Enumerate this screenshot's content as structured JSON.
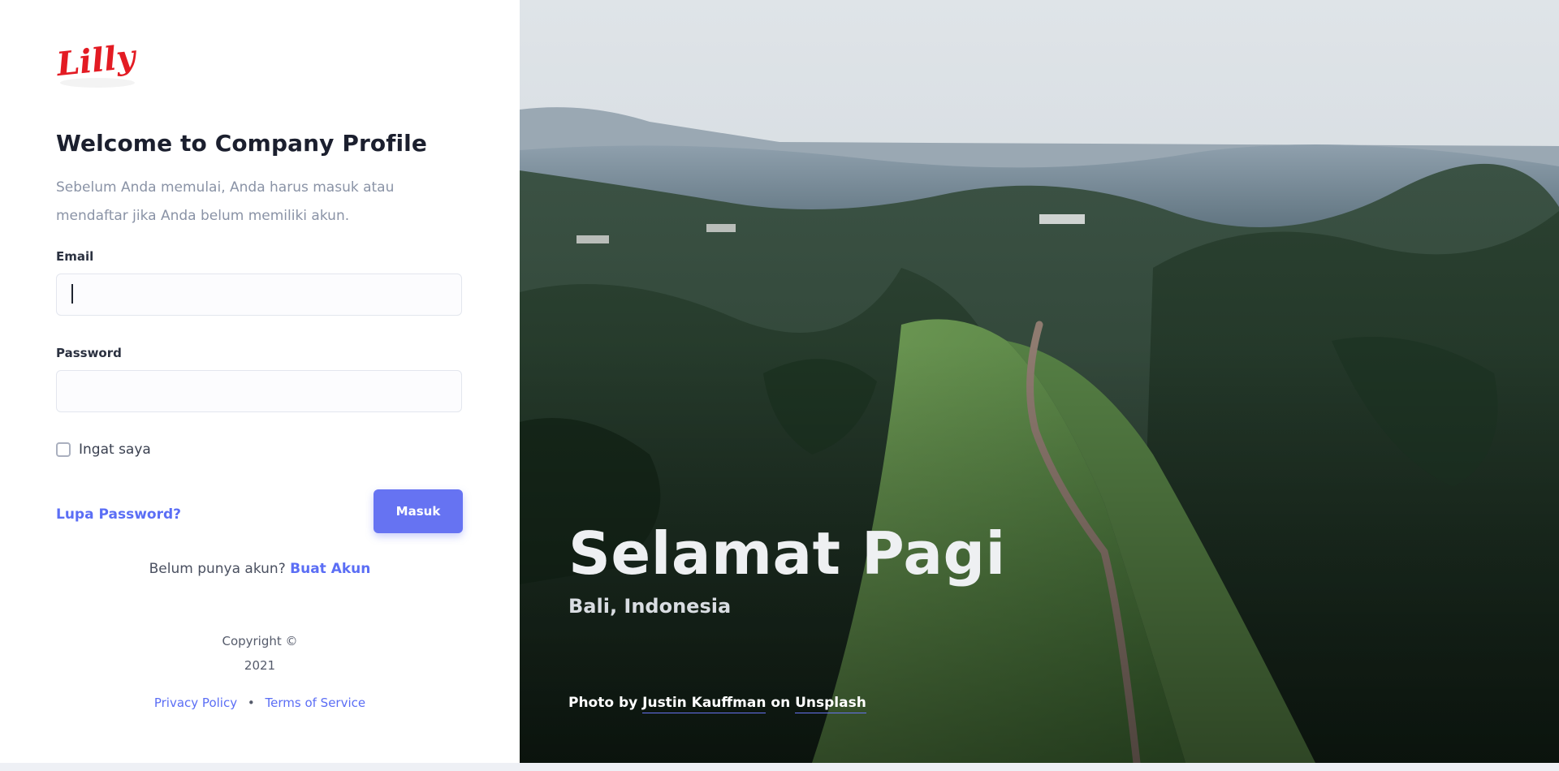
{
  "brand": {
    "logo_text": "Lilly",
    "logo_color": "#e31b23"
  },
  "login": {
    "title": "Welcome to Company Profile",
    "intro": "Sebelum Anda memulai, Anda harus masuk atau mendaftar jika Anda belum memiliki akun.",
    "email_label": "Email",
    "email_value": "",
    "password_label": "Password",
    "password_value": "",
    "remember_label": "Ingat saya",
    "remember_checked": false,
    "forgot_label": "Lupa Password?",
    "submit_label": "Masuk",
    "signup_prompt": "Belum punya akun?",
    "signup_link": "Buat Akun"
  },
  "footer": {
    "copyright": "Copyright ©",
    "year": "2021",
    "privacy": "Privacy Policy",
    "separator": "•",
    "terms": "Terms of Service"
  },
  "hero": {
    "greeting": "Selamat Pagi",
    "location": "Bali, Indonesia",
    "credit_prefix": "Photo by",
    "credit_author": "Justin Kauffman",
    "credit_on": "on",
    "credit_site": "Unsplash"
  },
  "colors": {
    "accent": "#6673f2",
    "link": "#5b6ef5",
    "muted": "#8a93a6"
  }
}
